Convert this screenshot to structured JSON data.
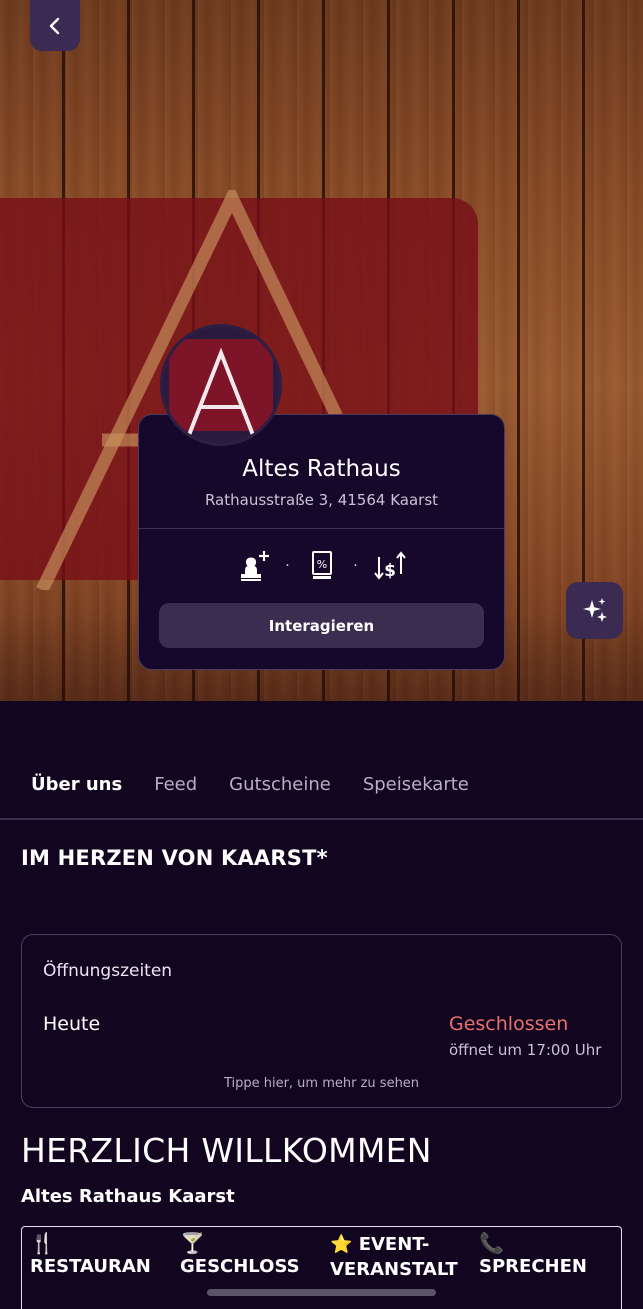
{
  "venue": {
    "name": "Altes Rathaus",
    "address": "Rathausstraße 3, 41564 Kaarst",
    "interact_label": "Interagieren",
    "separator": "·"
  },
  "tabs": [
    "Über uns",
    "Feed",
    "Gutscheine",
    "Speisekarte"
  ],
  "about": {
    "heading": "IM HERZEN VON KAARST*",
    "welcome": "HERZLICH WILLKOMMEN",
    "subheading": "Altes Rathaus Kaarst"
  },
  "hours": {
    "title": "Öffnungszeiten",
    "day": "Heute",
    "status": "Geschlossen",
    "next": "öffnet um 17:00 Uhr",
    "hint": "Tippe hier, um mehr zu sehen"
  },
  "categories": [
    {
      "emoji": "🍴",
      "label": "RESTAURAN"
    },
    {
      "emoji": "🍸",
      "label": "GESCHLOSS"
    },
    {
      "emoji": "⭐",
      "label": "EVENT-",
      "label2": "VERANSTALT"
    },
    {
      "emoji": "📞",
      "label": "SPRECHEN"
    }
  ],
  "colors": {
    "background": "#12051f",
    "card": "#15082a",
    "button": "#3a2d50",
    "status_closed": "#e8716d",
    "brand_red": "#7d1427"
  },
  "icons": [
    "back-icon",
    "sparkle-icon",
    "add-stamp-icon",
    "voucher-icon",
    "currency-exchange-icon"
  ]
}
